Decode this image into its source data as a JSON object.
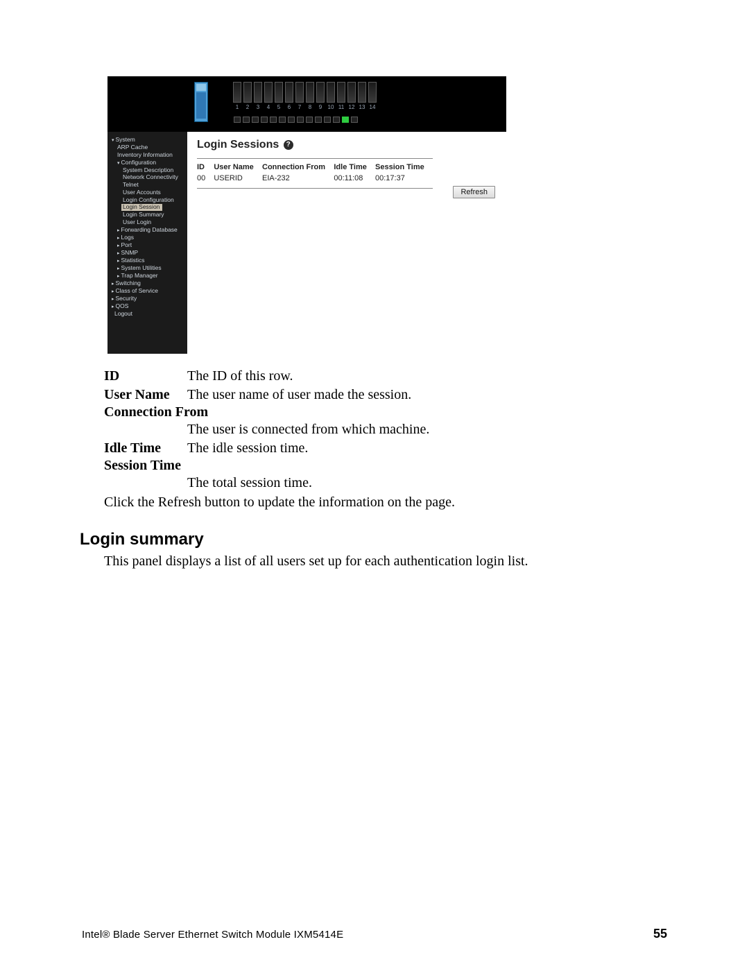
{
  "screenshot": {
    "ports": [
      "1",
      "2",
      "3",
      "4",
      "5",
      "6",
      "7",
      "8",
      "9",
      "10",
      "11",
      "12",
      "13",
      "14"
    ],
    "leds_on_index": 12,
    "nav": {
      "system": "System",
      "arp_cache": "ARP Cache",
      "inventory": "Inventory Information",
      "configuration": "Configuration",
      "sys_desc": "System Description",
      "net_conn": "Network Connectivity",
      "telnet": "Telnet",
      "user_accounts": "User Accounts",
      "login_config": "Login Configuration",
      "login_session": "Login Session",
      "login_summary": "Login Summary",
      "user_login": "User Login",
      "fwd_db": "Forwarding Database",
      "logs": "Logs",
      "port": "Port",
      "snmp": "SNMP",
      "statistics": "Statistics",
      "sys_util": "System Utilities",
      "trap_mgr": "Trap Manager",
      "switching": "Switching",
      "cos": "Class of Service",
      "security": "Security",
      "qos": "QOS",
      "logout": "Logout"
    },
    "content": {
      "title": "Login Sessions",
      "help": "?",
      "headers": {
        "id": "ID",
        "user": "User Name",
        "conn": "Connection From",
        "idle": "Idle Time",
        "sess": "Session Time"
      },
      "row": {
        "id": "00",
        "user": "USERID",
        "conn": "EIA-232",
        "idle": "00:11:08",
        "sess": "00:17:37"
      },
      "refresh": "Refresh"
    }
  },
  "defs": {
    "id_term": "ID",
    "id_desc": "The ID of this row.",
    "user_term": "User Name",
    "user_desc": "The user name of user made the session.",
    "conn_term": "Connection From",
    "conn_desc": "The user is connected from which machine.",
    "idle_term": "Idle Time",
    "idle_desc": "The idle session time.",
    "sess_term": "Session Time",
    "sess_desc": "The total session time."
  },
  "para_refresh": "Click the Refresh button to update the information on the page.",
  "section_heading": "Login summary",
  "section_body": "This panel displays a list of all users set up for each authentication login list.",
  "footer_product": "Intel® Blade Server Ethernet Switch Module IXM5414E",
  "footer_page": "55"
}
